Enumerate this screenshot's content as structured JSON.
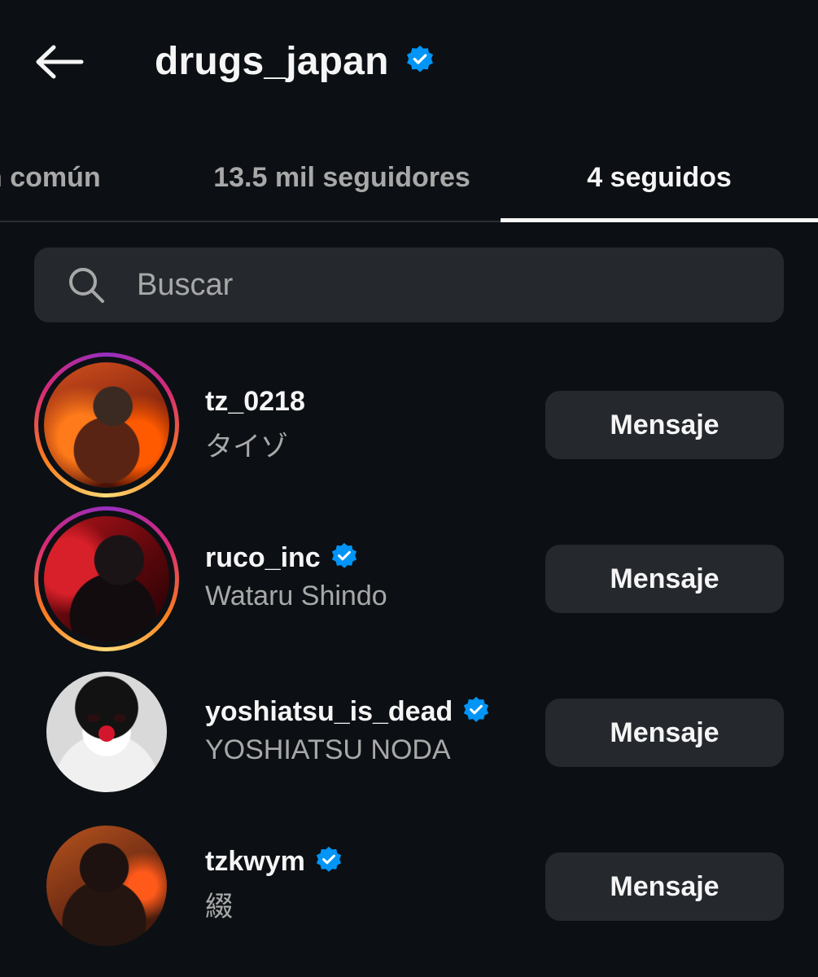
{
  "header": {
    "title": "drugs_japan",
    "verified": true,
    "back_icon": "arrow-left-icon"
  },
  "tabs": [
    {
      "label": "n común",
      "active": false
    },
    {
      "label": "13.5 mil seguidores",
      "active": false
    },
    {
      "label": "4 seguidos",
      "active": true
    }
  ],
  "search": {
    "placeholder": "Buscar",
    "value": "",
    "icon": "search-icon"
  },
  "colors": {
    "background": "#0c1014",
    "surface": "#25292e",
    "verified_blue": "#0095f6",
    "secondary_text": "#a8a8a8"
  },
  "accounts": [
    {
      "username": "tz_0218",
      "full_name": "タイゾ",
      "verified": false,
      "has_story": true,
      "button_label": "Mensaje"
    },
    {
      "username": "ruco_inc",
      "full_name": "Wataru Shindo",
      "verified": true,
      "has_story": true,
      "button_label": "Mensaje"
    },
    {
      "username": "yoshiatsu_is_dead",
      "full_name": "YOSHIATSU NODA",
      "verified": true,
      "has_story": false,
      "button_label": "Mensaje"
    },
    {
      "username": "tzkwym",
      "full_name": "綴",
      "verified": true,
      "has_story": false,
      "button_label": "Mensaje"
    }
  ]
}
